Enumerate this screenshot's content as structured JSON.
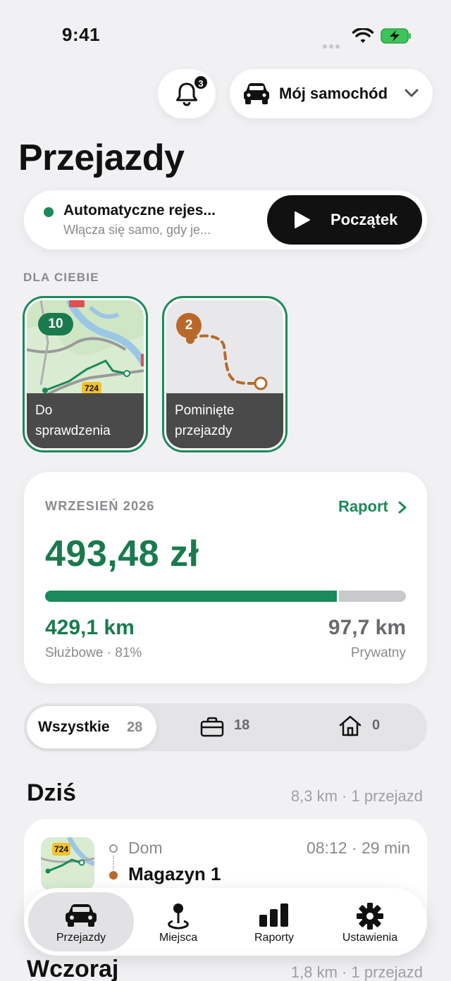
{
  "status_bar": {
    "time": "9:41"
  },
  "header": {
    "notifications_count": "3",
    "car_selector_label": "Mój samochód"
  },
  "page_title": "Przejazdy",
  "auto_record": {
    "title": "Automatyczne rejes...",
    "subtitle": "Włącza się samo, gdy je...",
    "start_label": "Początek",
    "status_color": "#1a8a5a"
  },
  "for_you": {
    "label": "DLA CIEBIE",
    "tiles": [
      {
        "count": "10",
        "line1": "Do",
        "line2": "sprawdzenia",
        "road_label": "724"
      },
      {
        "count": "2",
        "line1": "Pominięte",
        "line2": "przejazdy"
      }
    ]
  },
  "summary": {
    "month": "WRZESIEŃ 2026",
    "report_link": "Raport",
    "amount": "493,48 zł",
    "business_share": 0.815,
    "business_km": "429,1 km",
    "business_sub": "Służbowe · 81%",
    "private_km": "97,7 km",
    "private_sub": "Prywatny"
  },
  "filter": {
    "all_label": "Wszystkie",
    "all_count": "28",
    "business_count": "18",
    "private_count": "0"
  },
  "days": [
    {
      "title": "Dziś",
      "meta": "8,3 km · 1 przejazd",
      "trip": {
        "from": "Dom",
        "to": "Magazyn 1",
        "time": "08:12 · 29 min",
        "road_label": "724"
      }
    },
    {
      "title": "Wczoraj",
      "meta": "1,8 km · 1 przejazd"
    }
  ],
  "tabbar": {
    "items": [
      {
        "label": "Przejazdy",
        "icon": "car-icon",
        "active": true
      },
      {
        "label": "Miejsca",
        "icon": "map-pin-icon"
      },
      {
        "label": "Raporty",
        "icon": "bar-chart-icon"
      },
      {
        "label": "Ustawienia",
        "icon": "gear-icon"
      }
    ]
  },
  "colors": {
    "accent": "#1a8a5a",
    "accent_dark": "#1a7a4e",
    "skipped": "#b8692a"
  }
}
